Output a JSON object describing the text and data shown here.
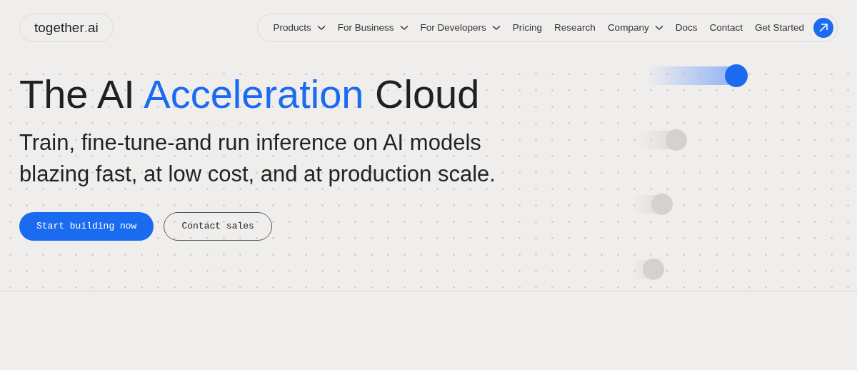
{
  "logo": {
    "name": "together",
    "dot": ".",
    "suffix": "ai"
  },
  "nav": [
    {
      "label": "Products",
      "dropdown": true
    },
    {
      "label": "For Business",
      "dropdown": true
    },
    {
      "label": "For Developers",
      "dropdown": true
    },
    {
      "label": "Pricing",
      "dropdown": false
    },
    {
      "label": "Research",
      "dropdown": false
    },
    {
      "label": "Company",
      "dropdown": true
    },
    {
      "label": "Docs",
      "dropdown": false
    },
    {
      "label": "Contact",
      "dropdown": false
    },
    {
      "label": "Get Started",
      "dropdown": false
    }
  ],
  "hero": {
    "headline": [
      {
        "text": "The AI",
        "accent": false
      },
      {
        "text": "Acceleration",
        "accent": true
      },
      {
        "text": "Cloud",
        "accent": false
      }
    ],
    "subtitle_lines": [
      "Train, fine-tune-and run inference on AI models",
      "blazing fast, at low cost, and at production scale."
    ],
    "buttons": [
      {
        "label": "Start building now",
        "kind": "primary"
      },
      {
        "label": "Contact sales",
        "kind": "outline"
      }
    ]
  }
}
